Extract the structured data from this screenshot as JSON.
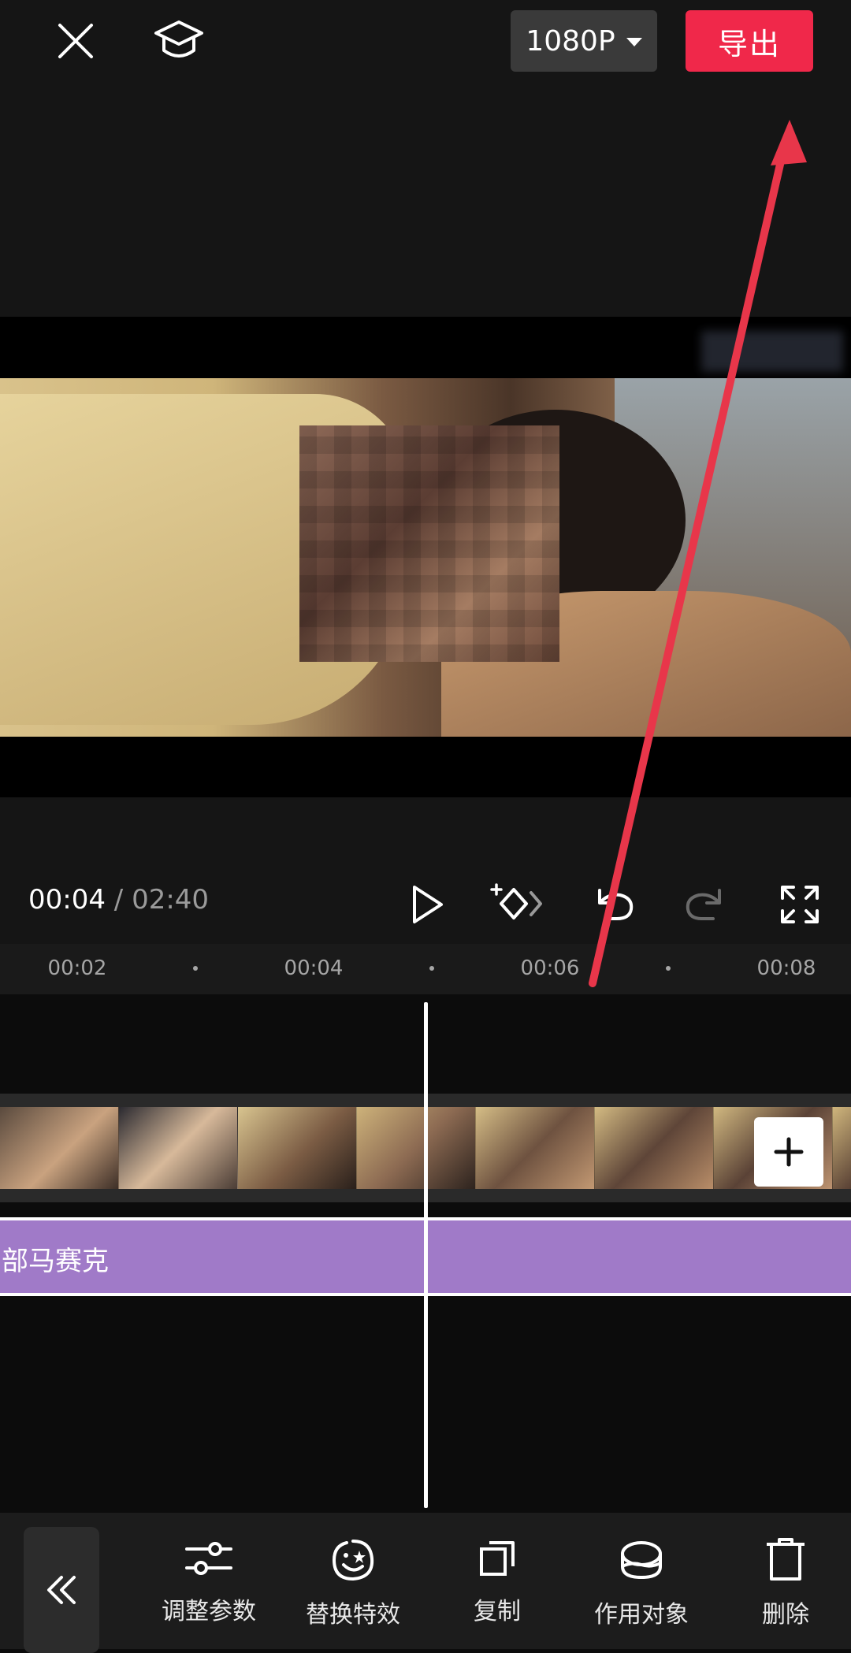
{
  "header": {
    "close_icon": "close-icon",
    "tutorial_icon": "graduation-cap-icon",
    "resolution": "1080P",
    "export_label": "导出"
  },
  "player": {
    "current_time": "00:04",
    "separator": "/",
    "total_time": "02:40"
  },
  "ruler": {
    "ticks": [
      "00:02",
      "00:04",
      "00:06",
      "00:08"
    ]
  },
  "tracks": {
    "effect_label": "部马赛克"
  },
  "toolbar": {
    "items": [
      {
        "label": "调整参数",
        "icon": "sliders-icon"
      },
      {
        "label": "替换特效",
        "icon": "face-star-icon"
      },
      {
        "label": "复制",
        "icon": "copy-icon"
      },
      {
        "label": "作用对象",
        "icon": "layers-icon"
      },
      {
        "label": "删除",
        "icon": "trash-icon"
      }
    ]
  },
  "colors": {
    "accent": "#f0284a",
    "effect_track": "#a07ac8",
    "annotation_arrow": "#e8364a"
  }
}
